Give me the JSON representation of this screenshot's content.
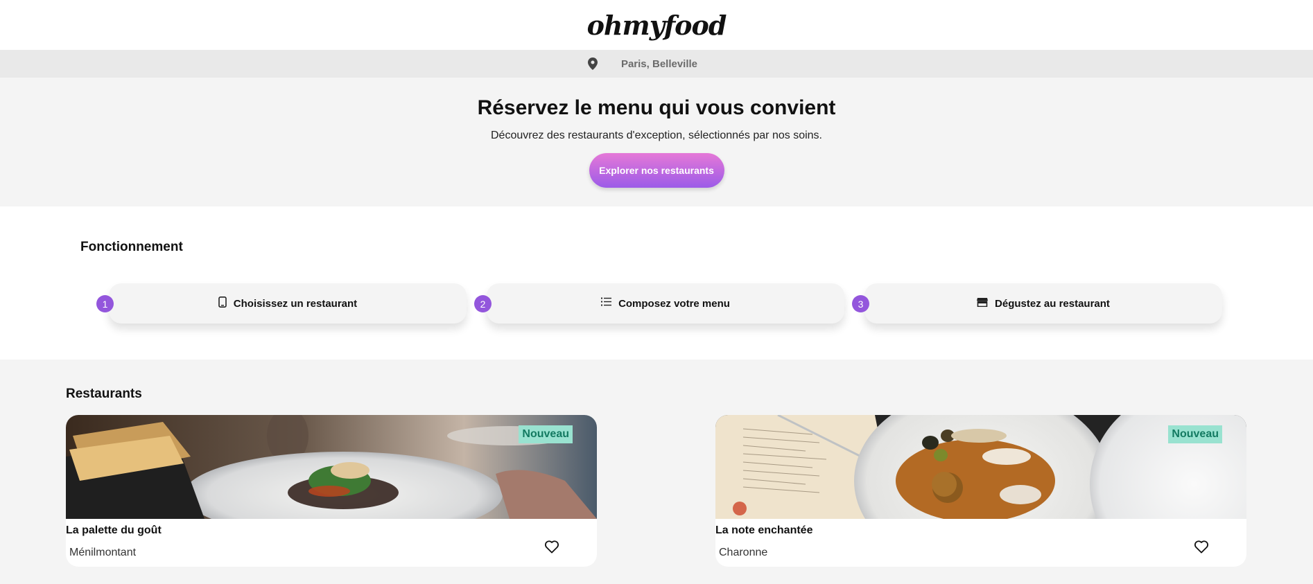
{
  "header": {
    "logo": "ohmyfood"
  },
  "location": {
    "icon": "map-pin-icon",
    "text": "Paris, Belleville"
  },
  "hero": {
    "title": "Réservez le menu qui vous convient",
    "subtitle": "Découvrez des restaurants d'exception, sélectionnés par nos soins.",
    "cta_label": "Explorer nos restaurants"
  },
  "how": {
    "title": "Fonctionnement",
    "steps": [
      {
        "number": "1",
        "icon": "smartphone-icon",
        "label": "Choisissez un restaurant"
      },
      {
        "number": "2",
        "icon": "list-icon",
        "label": "Composez votre menu"
      },
      {
        "number": "3",
        "icon": "store-icon",
        "label": "Dégustez au restaurant"
      }
    ]
  },
  "restaurants": {
    "title": "Restaurants",
    "cards": [
      {
        "name": "La palette du goût",
        "area": "Ménilmontant",
        "badge": "Nouveau",
        "icon": "heart-icon"
      },
      {
        "name": "La note enchantée",
        "area": "Charonne",
        "badge": "Nouveau",
        "icon": "heart-icon"
      }
    ]
  },
  "colors": {
    "accent_purple": "#9356dc",
    "accent_pink": "#e578d7",
    "badge_bg": "#99e2d0",
    "badge_text": "#137a61",
    "location_bar": "#e9e9e9",
    "section_bg": "#f4f4f4"
  }
}
